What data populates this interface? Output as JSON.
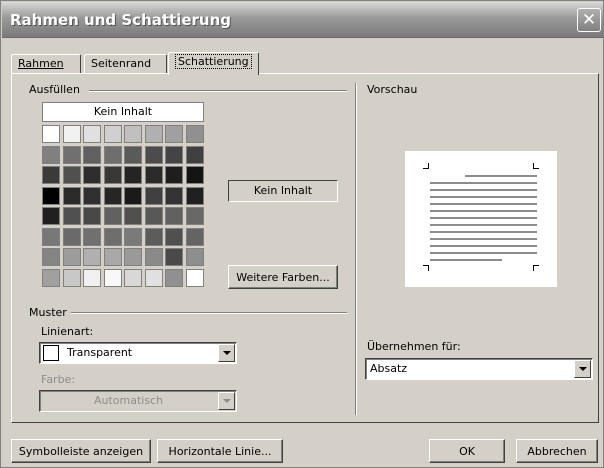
{
  "window": {
    "title": "Rahmen und Schattierung",
    "close_glyph": "✕"
  },
  "tabs": [
    {
      "label": "Rahmen",
      "active": false
    },
    {
      "label": "Seitenrand",
      "active": false
    },
    {
      "label": "Schattierung",
      "active": true
    }
  ],
  "fill": {
    "group_label": "Ausfüllen",
    "none_label": "Kein Inhalt",
    "current_label": "Kein Inhalt",
    "more_colors_label": "Weitere Farben..."
  },
  "swatch_colors": [
    [
      "#ffffff",
      "#f0f0f0",
      "#e0e0e0",
      "#d0d0d0",
      "#c0c0c0",
      "#b0b0b0",
      "#a0a0a0",
      "#909090"
    ],
    [
      "#808080",
      "#707070",
      "#606060",
      "#6e6e6e",
      "#5a5a5a",
      "#4c4c4c",
      "#444444",
      "#404040"
    ],
    [
      "#3a3a3a",
      "#505050",
      "#2e2e2e",
      "#383838",
      "#242424",
      "#2a2a2a",
      "#1e1e1e",
      "#141414"
    ],
    [
      "#000000",
      "#2a2a2a",
      "#303030",
      "#262626",
      "#1a1a1a",
      "#404040",
      "#333333",
      "#202020"
    ],
    [
      "#202020",
      "#505050",
      "#484848",
      "#606060",
      "#505050",
      "#585858",
      "#606060",
      "#686868"
    ],
    [
      "#787878",
      "#6a6a6a",
      "#707070",
      "#6e6e6e",
      "#7a7a7a",
      "#5c5c5c",
      "#505050",
      "#646464"
    ],
    [
      "#848484",
      "#9c9c9c",
      "#b0b0b0",
      "#a8a8a8",
      "#9a9a9a",
      "#8a8a8a",
      "#4a4a4a",
      "#8e8e8e"
    ],
    [
      "#a0a0a0",
      "#c8c8c8",
      "#f0f0f0",
      "#f8f8f8",
      "#d8d8d8",
      "#e0e0e0",
      "#909090",
      "#ffffff"
    ]
  ],
  "pattern": {
    "group_label": "Muster",
    "style_label": "Linienart:",
    "style_value": "Transparent",
    "color_label": "Farbe:",
    "color_value": "Automatisch"
  },
  "preview": {
    "group_label": "Vorschau"
  },
  "apply_to": {
    "label": "Übernehmen für:",
    "value": "Absatz"
  },
  "footer": {
    "toolbar_label": "Symbolleiste anzeigen",
    "hline_label": "Horizontale Linie...",
    "ok_label": "OK",
    "cancel_label": "Abbrechen"
  }
}
